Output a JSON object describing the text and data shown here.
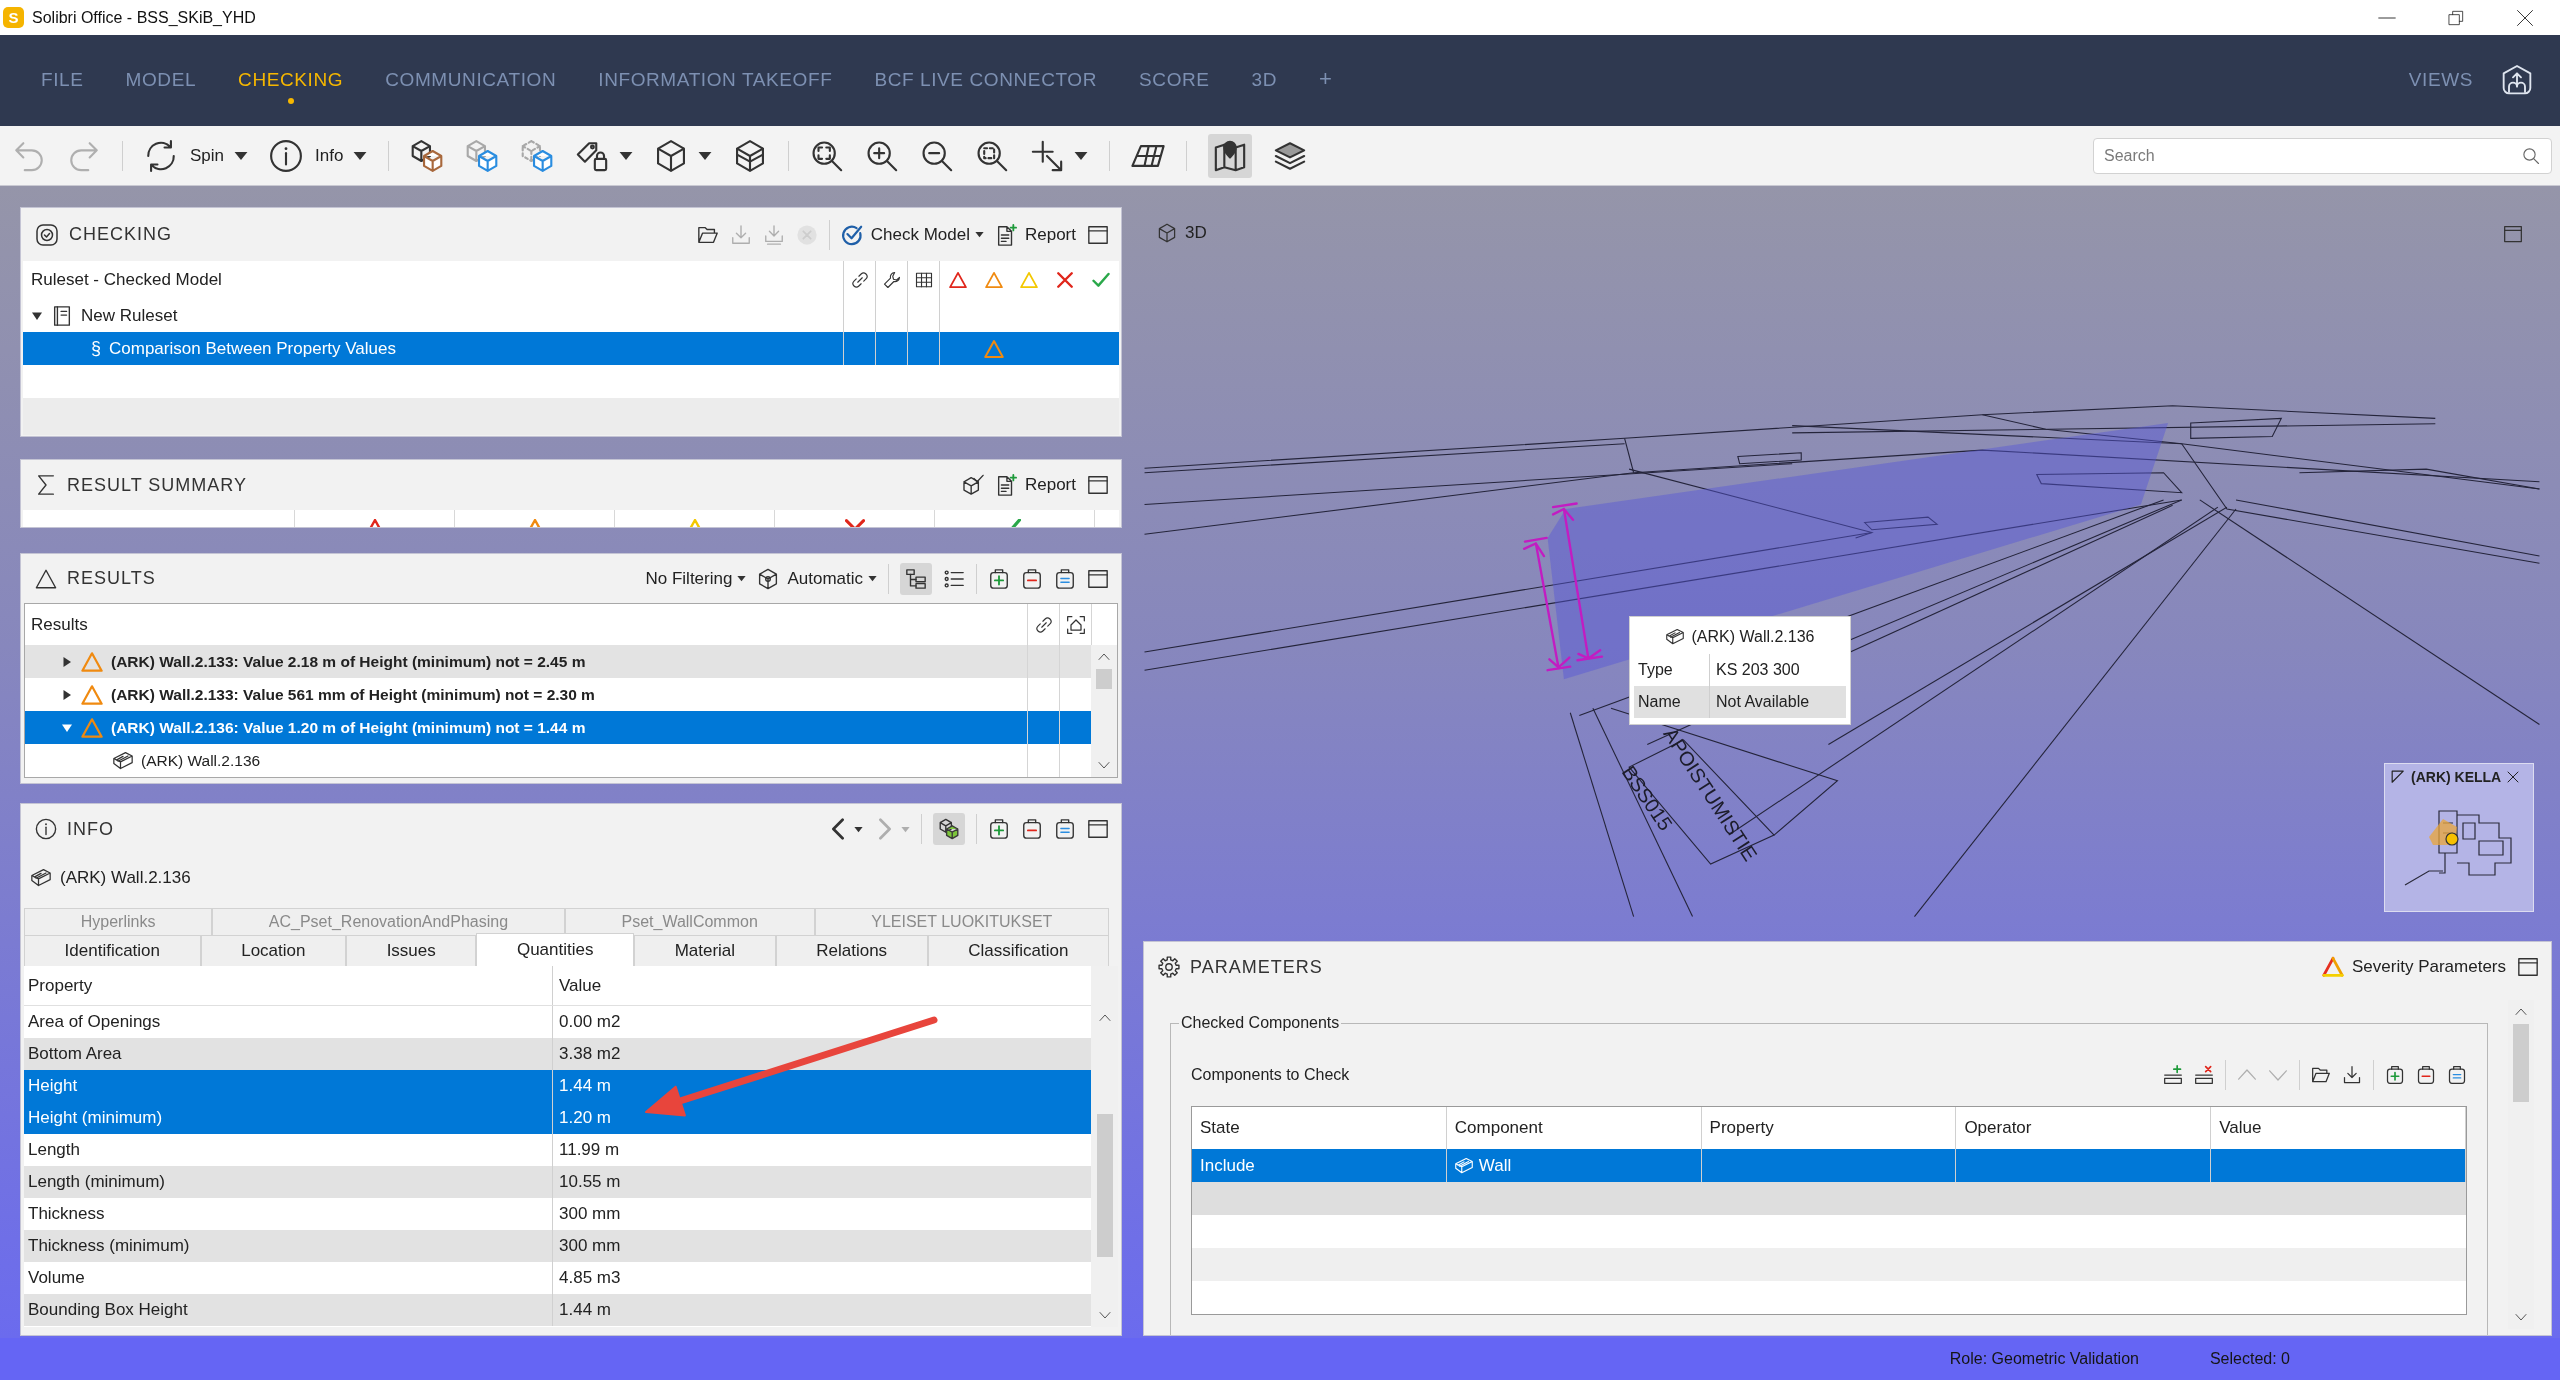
{
  "window": {
    "app_icon_letter": "S",
    "title": "Solibri Office - BSS_SKiB_YHD"
  },
  "menu": {
    "tabs": [
      {
        "label": "FILE",
        "selected": false
      },
      {
        "label": "MODEL",
        "selected": false
      },
      {
        "label": "CHECKING",
        "selected": true
      },
      {
        "label": "COMMUNICATION",
        "selected": false
      },
      {
        "label": "INFORMATION TAKEOFF",
        "selected": false
      },
      {
        "label": "BCF LIVE CONNECTOR",
        "selected": false
      },
      {
        "label": "SCORE",
        "selected": false
      },
      {
        "label": "3D",
        "selected": false
      }
    ],
    "add_tab": "+",
    "views": "VIEWS"
  },
  "toolbar": {
    "groups": [
      [
        {
          "kind": "undo",
          "disabled": true,
          "pressed": false
        },
        {
          "kind": "redo",
          "disabled": true,
          "pressed": false
        }
      ],
      [
        {
          "kind": "spin",
          "label": "Spin",
          "disabled": false,
          "pressed": false
        },
        {
          "kind": "caret",
          "disabled": false,
          "pressed": false
        },
        {
          "kind": "info",
          "label": "Info",
          "disabled": false,
          "pressed": false
        },
        {
          "kind": "caret",
          "disabled": false,
          "pressed": false
        }
      ],
      [
        {
          "kind": "cubes",
          "disabled": false,
          "pressed": false
        },
        {
          "kind": "hide",
          "disabled": false,
          "pressed": false
        },
        {
          "kind": "transparent",
          "disabled": false,
          "pressed": false
        },
        {
          "kind": "paint",
          "disabled": false,
          "pressed": false
        },
        {
          "kind": "caret",
          "disabled": false,
          "pressed": false
        },
        {
          "kind": "box",
          "disabled": false,
          "pressed": false
        },
        {
          "kind": "caret",
          "disabled": false,
          "pressed": false
        },
        {
          "kind": "section-box",
          "disabled": false,
          "pressed": false
        }
      ],
      [
        {
          "kind": "zoom-fit",
          "disabled": false,
          "pressed": false
        },
        {
          "kind": "zoom-in",
          "disabled": false,
          "pressed": false
        },
        {
          "kind": "zoom-out",
          "disabled": false,
          "pressed": false
        },
        {
          "kind": "zoom-window",
          "disabled": false,
          "pressed": false
        },
        {
          "kind": "select",
          "disabled": false,
          "pressed": false
        },
        {
          "kind": "caret",
          "disabled": false,
          "pressed": false
        }
      ],
      [
        {
          "kind": "floor-grid",
          "disabled": false,
          "pressed": false
        }
      ],
      [
        {
          "kind": "map",
          "disabled": false,
          "pressed": true
        },
        {
          "kind": "layers",
          "disabled": false,
          "pressed": false
        }
      ]
    ],
    "search": {
      "placeholder": "Search"
    }
  },
  "checking": {
    "title": "CHECKING",
    "tools": [
      [
        {
          "kind": "folder-open",
          "disabled": false,
          "pressed": false
        },
        {
          "kind": "download",
          "disabled": true,
          "pressed": false
        },
        {
          "kind": "download-all",
          "disabled": true,
          "pressed": false
        },
        {
          "kind": "stop",
          "disabled": true,
          "pressed": false
        }
      ],
      [
        {
          "kind": "check-model",
          "label": "Check Model",
          "disabled": false,
          "pressed": false
        },
        {
          "kind": "caret",
          "disabled": false,
          "pressed": false
        },
        {
          "kind": "report",
          "label": "Report",
          "disabled": false,
          "pressed": false
        },
        {
          "kind": "maximize",
          "disabled": false,
          "pressed": false
        }
      ]
    ],
    "table_title": "Ruleset - Checked Model",
    "tree": [
      {
        "kind": "ruleset",
        "label": "New Ruleset",
        "expanded": true,
        "selected": false,
        "children": [
          {
            "kind": "rule",
            "glyph": "§",
            "label": "Comparison Between Property Values",
            "selected": true,
            "moderate": true
          }
        ]
      }
    ]
  },
  "result_summary": {
    "title": "RESULT SUMMARY",
    "tools": [
      [
        {
          "kind": "cube-check",
          "disabled": false,
          "pressed": false
        },
        {
          "kind": "report",
          "label": "Report",
          "disabled": false,
          "pressed": false
        },
        {
          "kind": "maximize",
          "disabled": false,
          "pressed": false
        }
      ]
    ]
  },
  "results": {
    "title": "RESULTS",
    "tools": [
      [
        {
          "kind": "filter",
          "label": "No Filtering",
          "disabled": false,
          "pressed": false
        },
        {
          "kind": "caret",
          "disabled": false,
          "pressed": false
        },
        {
          "kind": "automatic",
          "label": "Automatic",
          "disabled": false,
          "pressed": false
        },
        {
          "kind": "caret",
          "disabled": false,
          "pressed": false
        }
      ],
      [
        {
          "kind": "tree",
          "disabled": false,
          "pressed": true
        },
        {
          "kind": "list",
          "disabled": false,
          "pressed": false
        }
      ],
      [
        {
          "kind": "plus",
          "disabled": false,
          "pressed": false
        },
        {
          "kind": "minus",
          "disabled": false,
          "pressed": false
        },
        {
          "kind": "equals",
          "disabled": false,
          "pressed": false
        },
        {
          "kind": "maximize",
          "disabled": false,
          "pressed": false
        }
      ]
    ],
    "column_title": "Results",
    "items": [
      {
        "kind": "issue",
        "moderate": true,
        "text": "(ARK) Wall.2.133: Value 2.18 m of Height (minimum) not = 2.45 m",
        "expanded": false,
        "selected": false
      },
      {
        "kind": "issue",
        "moderate": true,
        "text": "(ARK) Wall.2.133: Value 561 mm of Height (minimum) not = 2.30 m",
        "expanded": false,
        "selected": false
      },
      {
        "kind": "issue",
        "moderate": true,
        "text": "(ARK) Wall.2.136: Value 1.20 m of Height (minimum) not = 1.44 m",
        "expanded": true,
        "selected": true,
        "children": [
          {
            "kind": "component",
            "text": "(ARK) Wall.2.136",
            "selected": false
          }
        ]
      }
    ]
  },
  "info": {
    "title": "INFO",
    "tools": [
      [
        {
          "kind": "back",
          "disabled": false,
          "pressed": false
        },
        {
          "kind": "caret",
          "disabled": false,
          "pressed": false
        },
        {
          "kind": "forward",
          "disabled": true,
          "pressed": false
        },
        {
          "kind": "caret",
          "disabled": true,
          "pressed": false
        }
      ],
      [
        {
          "kind": "cube-green",
          "disabled": false,
          "pressed": true
        }
      ],
      [
        {
          "kind": "plus",
          "disabled": false,
          "pressed": false
        },
        {
          "kind": "minus",
          "disabled": false,
          "pressed": false
        },
        {
          "kind": "equals",
          "disabled": false,
          "pressed": false
        },
        {
          "kind": "maximize",
          "disabled": false,
          "pressed": false
        }
      ]
    ],
    "component": "(ARK) Wall.2.136",
    "tabs_back": [
      {
        "label": "Hyperlinks",
        "selected": false
      },
      {
        "label": "AC_Pset_RenovationAndPhasing",
        "selected": false
      },
      {
        "label": "Pset_WallCommon",
        "selected": false
      },
      {
        "label": "YLEISET LUOKITUKSET",
        "selected": false
      }
    ],
    "tabs_front": [
      {
        "label": "Identification",
        "selected": false
      },
      {
        "label": "Location",
        "selected": false
      },
      {
        "label": "Issues",
        "selected": false
      },
      {
        "label": "Quantities",
        "selected": true
      },
      {
        "label": "Material",
        "selected": false
      },
      {
        "label": "Relations",
        "selected": false
      },
      {
        "label": "Classification",
        "selected": false
      }
    ],
    "columns": [
      "Property",
      "Value"
    ],
    "rows": [
      {
        "property": "Area of Openings",
        "value": "0.00 m2",
        "selected": false
      },
      {
        "property": "Bottom Area",
        "value": "3.38 m2",
        "selected": false
      },
      {
        "property": "Height",
        "value": "1.44 m",
        "selected": true
      },
      {
        "property": "Height (minimum)",
        "value": "1.20 m",
        "selected": true
      },
      {
        "property": "Length",
        "value": "11.99 m",
        "selected": false
      },
      {
        "property": "Length (minimum)",
        "value": "10.55 m",
        "selected": false
      },
      {
        "property": "Thickness",
        "value": "300 mm",
        "selected": false
      },
      {
        "property": "Thickness (minimum)",
        "value": "300 mm",
        "selected": false
      },
      {
        "property": "Volume",
        "value": "4.85 m3",
        "selected": false
      },
      {
        "property": "Bounding Box Height",
        "value": "1.44 m",
        "selected": false
      }
    ]
  },
  "viewport": {
    "title": "3D",
    "scene_labels": [
      "APOISTUMISTIE",
      "BSS015"
    ],
    "tooltip": {
      "title": "(ARK) Wall.2.136",
      "rows": [
        {
          "label": "Type",
          "value": "KS 203 300"
        },
        {
          "label": "Name",
          "value": "Not Available"
        }
      ]
    },
    "minimap": {
      "title": "(ARK) KELLA"
    }
  },
  "parameters": {
    "title": "PARAMETERS",
    "tools": [
      [
        {
          "kind": "severity",
          "label": "Severity Parameters",
          "disabled": false,
          "pressed": false
        },
        {
          "kind": "maximize",
          "disabled": false,
          "pressed": false
        }
      ]
    ],
    "group_title": "Checked Components",
    "subtitle": "Components to Check",
    "table_tools": [
      [
        {
          "kind": "add-row",
          "disabled": false,
          "pressed": false
        },
        {
          "kind": "remove-row",
          "disabled": false,
          "pressed": false
        }
      ],
      [
        {
          "kind": "up",
          "disabled": true,
          "pressed": false
        },
        {
          "kind": "down",
          "disabled": true,
          "pressed": false
        }
      ],
      [
        {
          "kind": "folder-open",
          "disabled": false,
          "pressed": false
        },
        {
          "kind": "download",
          "disabled": false,
          "pressed": false
        }
      ],
      [
        {
          "kind": "plus",
          "disabled": false,
          "pressed": false
        },
        {
          "kind": "minus",
          "disabled": false,
          "pressed": false
        },
        {
          "kind": "equals",
          "disabled": false,
          "pressed": false
        }
      ]
    ],
    "columns": [
      "State",
      "Component",
      "Property",
      "Operator",
      "Value"
    ],
    "rows": [
      {
        "state": "Include",
        "component": "Wall",
        "selected": true
      }
    ]
  },
  "status_bar": {
    "role": "Role: Geometric Validation",
    "selection_count": "Selected: 0"
  }
}
